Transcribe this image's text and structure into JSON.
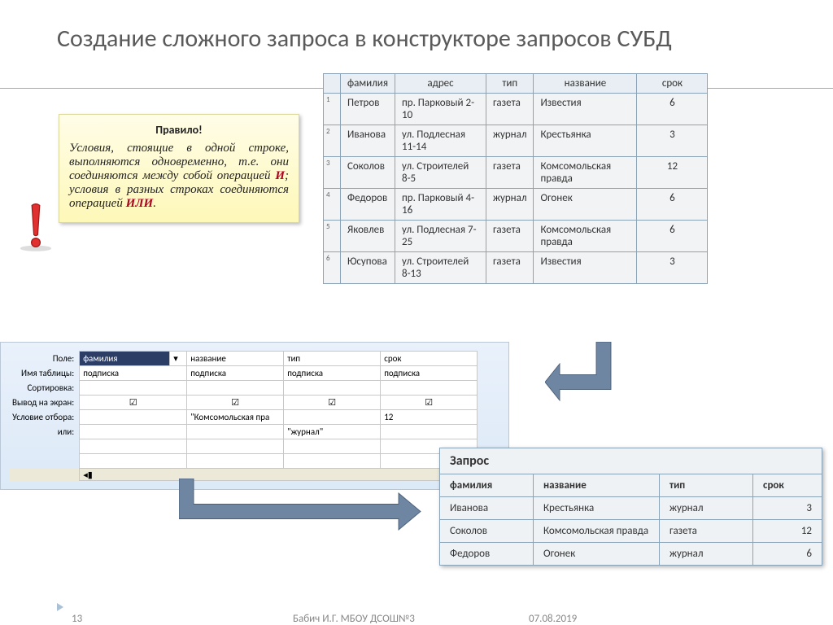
{
  "title": "Создание сложного запроса в конструкторе запросов СУБД",
  "rule": {
    "heading": "Правило!",
    "text1": "Условия, стоящие в одной строке, выполняются одновременно, т.е. они соединяются между собой операцией ",
    "and": "И",
    "text2": "; условия в разных строках соединяются операцией ",
    "or": "ИЛИ",
    "text3": "."
  },
  "dt": {
    "headers": [
      "фамилия",
      "адрес",
      "тип",
      "название",
      "срок"
    ],
    "rows": [
      {
        "n": "1",
        "c": [
          "Петров",
          "пр. Парковый 2-10",
          "газета",
          "Известия",
          "6"
        ]
      },
      {
        "n": "2",
        "c": [
          "Иванова",
          "ул. Подлесная 11-14",
          "журнал",
          "Крестьянка",
          "3"
        ]
      },
      {
        "n": "3",
        "c": [
          "Соколов",
          "ул. Строителей 8-5",
          "газета",
          "Комсомольская правда",
          "12"
        ]
      },
      {
        "n": "4",
        "c": [
          "Федоров",
          "пр. Парковый 4-16",
          "журнал",
          "Огонек",
          "6"
        ]
      },
      {
        "n": "5",
        "c": [
          "Яковлев",
          "ул. Подлесная 7-25",
          "газета",
          "Комсомольская правда",
          "6"
        ]
      },
      {
        "n": "6",
        "c": [
          "Юсупова",
          "ул. Строителей 8-13",
          "газета",
          "Известия",
          "3"
        ]
      }
    ]
  },
  "grid": {
    "labels": {
      "field": "Поле:",
      "table": "Имя таблицы:",
      "sort": "Сортировка:",
      "show": "Вывод на экран:",
      "crit": "Условие отбора:",
      "or": "или:"
    },
    "row_field": [
      "фамилия",
      "название",
      "тип",
      "срок"
    ],
    "row_table": [
      "подписка",
      "подписка",
      "подписка",
      "подписка"
    ],
    "row_crit": [
      "",
      "\"Комсомольская пра",
      "",
      "12"
    ],
    "row_or": [
      "",
      "",
      "\"журнал\"",
      ""
    ]
  },
  "query": {
    "title": "Запрос",
    "headers": [
      "фамилия",
      "название",
      "тип",
      "срок"
    ],
    "rows": [
      [
        "Иванова",
        "Крестьянка",
        "журнал",
        "3"
      ],
      [
        "Соколов",
        "Комсомольская правда",
        "газета",
        "12"
      ],
      [
        "Федоров",
        "Огонек",
        "журнал",
        "6"
      ]
    ]
  },
  "footer": {
    "page": "13",
    "author": "Бабич И.Г. МБОУ ДСОШ№3",
    "date": "07.08.2019"
  }
}
